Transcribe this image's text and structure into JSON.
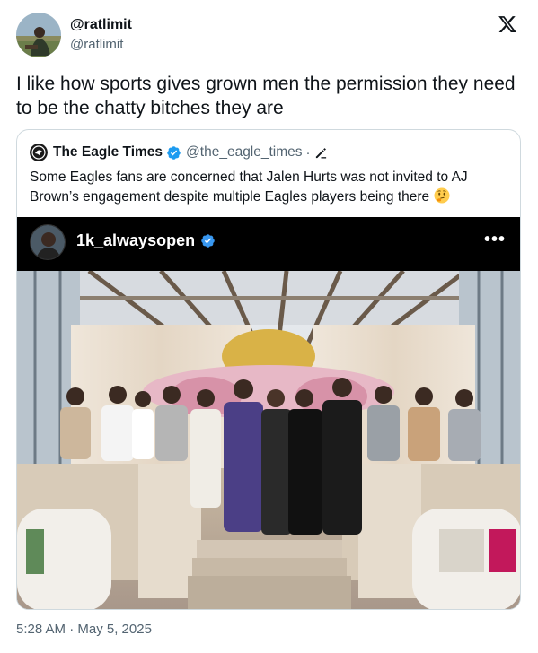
{
  "tweet": {
    "display_name": "@ratlimit",
    "handle": "@ratlimit",
    "text": "I like how sports gives grown men the permission they need to be the chatty bitches they are",
    "timestamp": "5:28 AM · May 5, 2025"
  },
  "quote": {
    "display_name": "The Eagle Times",
    "handle": "@the_eagle_times",
    "separator": "·",
    "text": "Some Eagles fans are concerned that Jalen Hurts was not invited to AJ Brown’s engagement despite multiple Eagles players being there",
    "emoji": "thinking-face"
  },
  "media": {
    "username": "1k_alwaysopen",
    "more": "•••"
  },
  "colors": {
    "text": "#0f1419",
    "secondary": "#536471",
    "verified": "#1d9bf0",
    "border": "#cfd9de"
  }
}
